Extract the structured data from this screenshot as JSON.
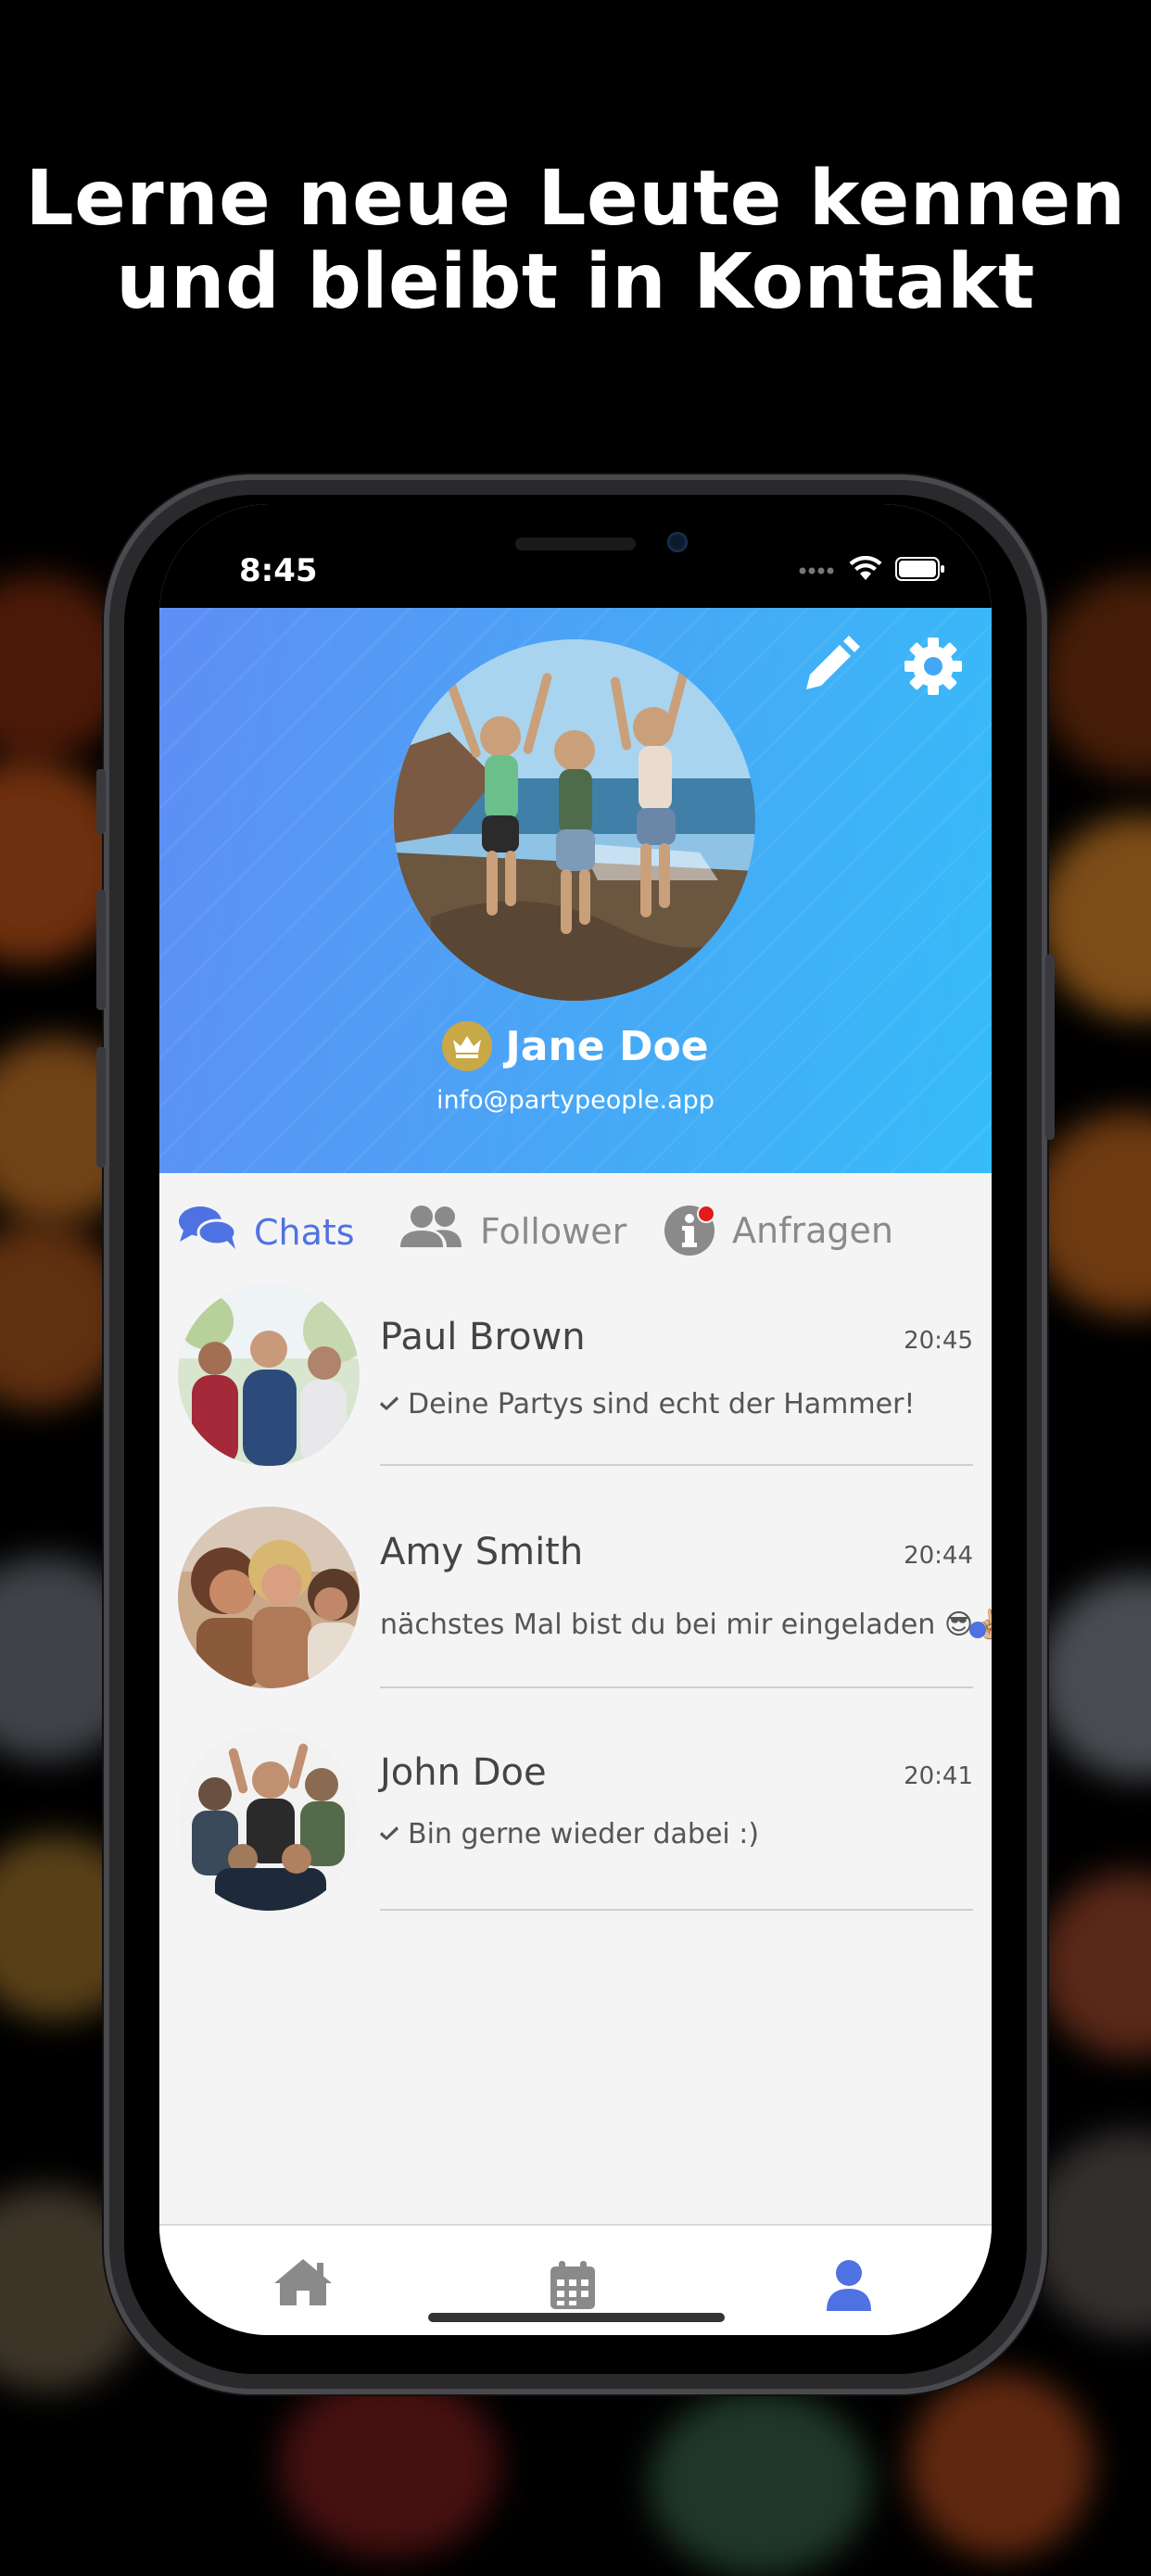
{
  "headline": {
    "line1": "Lerne neue Leute kennen",
    "line2": "und bleibt in Kontakt"
  },
  "status_bar": {
    "time": "8:45",
    "icons": [
      "signal-dots-icon",
      "wifi-icon",
      "battery-icon"
    ]
  },
  "profile": {
    "name": "Jane Doe",
    "email": "info@partypeople.app",
    "badge_icon": "crown-icon",
    "header_icons": [
      "pencil-icon",
      "gear-icon"
    ]
  },
  "tabs": [
    {
      "label": "Chats",
      "icon": "chat-bubbles-icon",
      "active": true
    },
    {
      "label": "Follower",
      "icon": "users-icon",
      "active": false
    },
    {
      "label": "Anfragen",
      "icon": "info-icon",
      "active": false,
      "notification_dot": true
    }
  ],
  "chats": [
    {
      "name": "Paul Brown",
      "time": "20:45",
      "message": "Deine Partys sind echt der Hammer!",
      "read_check": true,
      "unread": false
    },
    {
      "name": "Amy Smith",
      "time": "20:44",
      "message": "nächstes Mal bist du bei mir eingeladen 😎✌🏼",
      "read_check": false,
      "unread": true
    },
    {
      "name": "John Doe",
      "time": "20:41",
      "message": "Bin gerne wieder dabei :)",
      "read_check": true,
      "unread": false
    }
  ],
  "bottom_nav": [
    {
      "icon": "home-icon",
      "active": false
    },
    {
      "icon": "calendar-icon",
      "active": false
    },
    {
      "icon": "user-icon",
      "active": true
    }
  ],
  "colors": {
    "accent": "#4f72e3",
    "header_start": "#5f8ef4",
    "header_end": "#36bcf8",
    "crown": "#c9a846",
    "inactive": "#8a8a8a"
  }
}
